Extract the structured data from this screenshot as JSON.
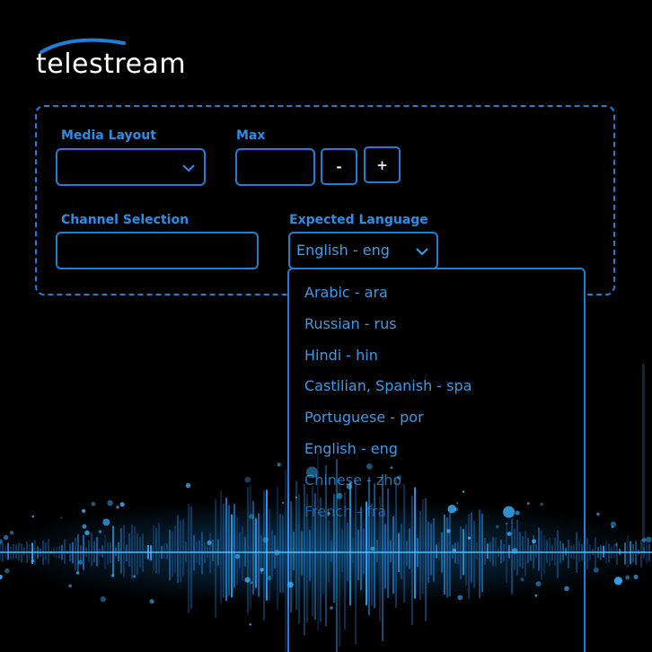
{
  "brand": {
    "logo_text": "telestream"
  },
  "form": {
    "media_layout": {
      "label": "Media Layout",
      "value": ""
    },
    "max": {
      "label": "Max",
      "value": "",
      "decrement_label": "-",
      "increment_label": "+"
    },
    "channel_selection": {
      "label": "Channel Selection",
      "value": ""
    },
    "expected_language": {
      "label": "Expected Language",
      "value": "English - eng"
    }
  },
  "dropdown": {
    "options": [
      "Arabic - ara",
      "Russian - rus",
      "Hindi - hin",
      "Castilian, Spanish - spa",
      "Portuguese - por",
      "English - eng",
      "Chinese - zho",
      "French - fra"
    ]
  },
  "colors": {
    "background": "#000000",
    "accent": "#1e7fd6",
    "text_blue": "#2a8ee8",
    "logo": "#ffffff"
  },
  "icons": {
    "chevron": "chevron-down-icon",
    "logo_swoosh": "swoosh-icon",
    "waveform": "audio-waveform"
  }
}
